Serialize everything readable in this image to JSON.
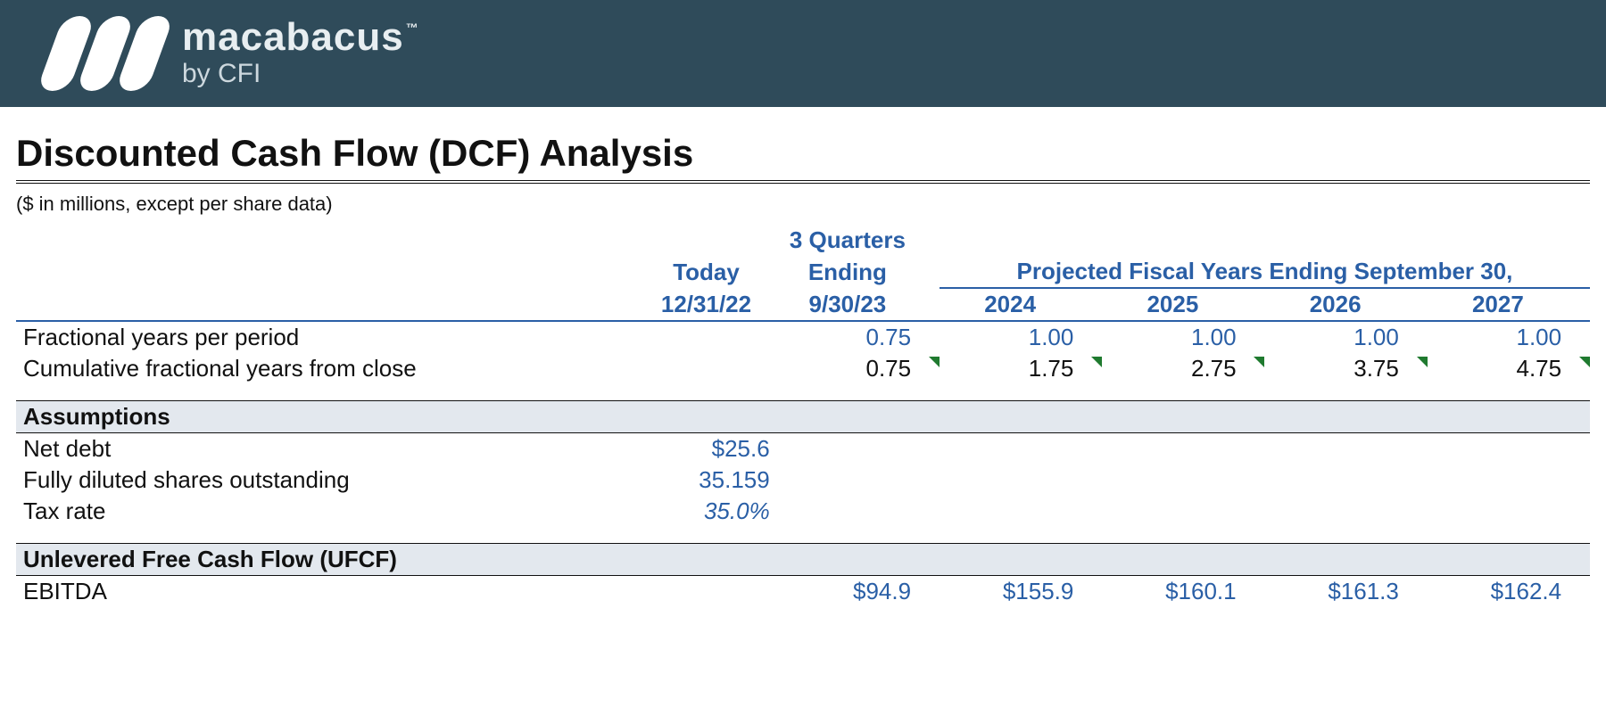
{
  "brand": {
    "name": "macabacus",
    "tm": "™",
    "subtitle": "by CFI"
  },
  "title": "Discounted Cash Flow (DCF) Analysis",
  "units_note": "($ in millions, except per share data)",
  "headers": {
    "today_label": "Today",
    "today_date": "12/31/22",
    "stub_label_top": "3 Quarters",
    "stub_label_bot": "Ending",
    "stub_date": "9/30/23",
    "proj_label": "Projected Fiscal Years Ending September 30,",
    "years": [
      "2024",
      "2025",
      "2026",
      "2027"
    ]
  },
  "rows": {
    "frac_years": {
      "label": "Fractional years per period",
      "stub": "0.75",
      "proj": [
        "1.00",
        "1.00",
        "1.00",
        "1.00"
      ]
    },
    "cum_frac": {
      "label": "Cumulative fractional years from close",
      "stub": "0.75",
      "proj": [
        "1.75",
        "2.75",
        "3.75",
        "4.75"
      ]
    },
    "assumptions_header": "Assumptions",
    "net_debt": {
      "label": "Net debt",
      "today": "$25.6"
    },
    "shares": {
      "label": "Fully diluted shares outstanding",
      "today": "35.159"
    },
    "tax": {
      "label": "Tax rate",
      "today": "35.0%"
    },
    "ufcf_header": "Unlevered Free Cash Flow (UFCF)",
    "ebitda": {
      "label": "EBITDA",
      "stub": "$94.9",
      "proj": [
        "$155.9",
        "$160.1",
        "$161.3",
        "$162.4"
      ]
    }
  }
}
